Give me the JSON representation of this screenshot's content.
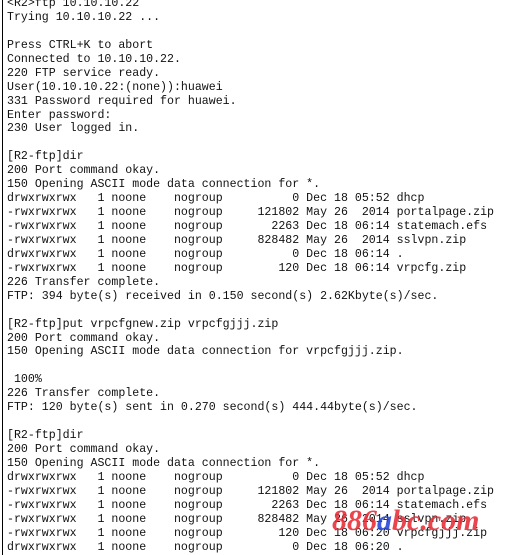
{
  "terminal": {
    "lines": [
      "<R2>ftp 10.10.10.22",
      "Trying 10.10.10.22 ...",
      "",
      "Press CTRL+K to abort",
      "Connected to 10.10.10.22.",
      "220 FTP service ready.",
      "User(10.10.10.22:(none)):huawei",
      "331 Password required for huawei.",
      "Enter password:",
      "230 User logged in.",
      "",
      "[R2-ftp]dir",
      "200 Port command okay.",
      "150 Opening ASCII mode data connection for *.",
      "drwxrwxrwx   1 noone    nogroup          0 Dec 18 05:52 dhcp",
      "-rwxrwxrwx   1 noone    nogroup     121802 May 26  2014 portalpage.zip",
      "-rwxrwxrwx   1 noone    nogroup       2263 Dec 18 06:14 statemach.efs",
      "-rwxrwxrwx   1 noone    nogroup     828482 May 26  2014 sslvpn.zip",
      "drwxrwxrwx   1 noone    nogroup          0 Dec 18 06:14 .",
      "-rwxrwxrwx   1 noone    nogroup        120 Dec 18 06:14 vrpcfg.zip",
      "226 Transfer complete.",
      "FTP: 394 byte(s) received in 0.150 second(s) 2.62Kbyte(s)/sec.",
      "",
      "[R2-ftp]put vrpcfgnew.zip vrpcfgjjj.zip",
      "200 Port command okay.",
      "150 Opening ASCII mode data connection for vrpcfgjjj.zip.",
      "",
      " 100%",
      "226 Transfer complete.",
      "FTP: 120 byte(s) sent in 0.270 second(s) 444.44byte(s)/sec.",
      "",
      "[R2-ftp]dir",
      "200 Port command okay.",
      "150 Opening ASCII mode data connection for *.",
      "drwxrwxrwx   1 noone    nogroup          0 Dec 18 05:52 dhcp",
      "-rwxrwxrwx   1 noone    nogroup     121802 May 26  2014 portalpage.zip",
      "-rwxrwxrwx   1 noone    nogroup       2263 Dec 18 06:14 statemach.efs",
      "-rwxrwxrwx   1 noone    nogroup     828482 May 26  2014 sslvpn.zip",
      "-rwxrwxrwx   1 noone    nogroup        120 Dec 18 06:20 vrpcfgjjj.zip",
      "drwxrwxrwx   1 noone    nogroup          0 Dec 18 06:20 ."
    ]
  },
  "watermark": {
    "text_red": "886",
    "text_blue": "a",
    "text_red2": "bc.com"
  },
  "colors": {
    "watermark_red": "#e8303a",
    "watermark_blue": "#2a48d8"
  }
}
